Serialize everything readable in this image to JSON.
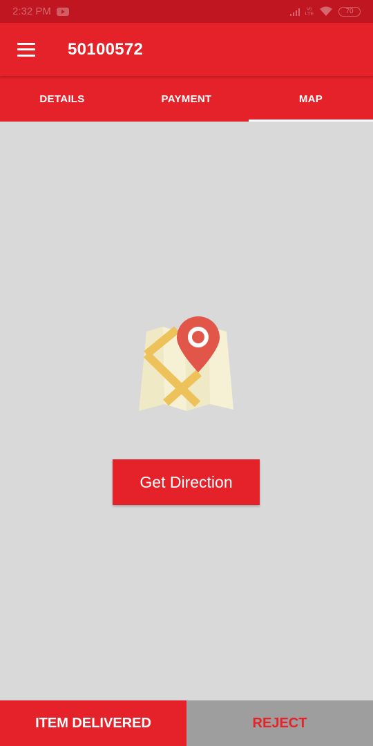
{
  "status_bar": {
    "time": "2:32 PM",
    "lte_label_top": "Vo",
    "lte_label_bottom": "LTE",
    "battery": "70"
  },
  "app_bar": {
    "title": "50100572",
    "menu_icon": "hamburger-menu-icon"
  },
  "tabs": [
    {
      "label": "DETAILS",
      "active": false
    },
    {
      "label": "PAYMENT",
      "active": false
    },
    {
      "label": "MAP",
      "active": true
    }
  ],
  "main": {
    "illustration": "map-pin-illustration",
    "get_direction_label": "Get Direction"
  },
  "actions": {
    "delivered_label": "ITEM DELIVERED",
    "reject_label": "REJECT"
  },
  "colors": {
    "primary": "#e52129",
    "status_bar": "#bf1622",
    "background": "#d9d9d9",
    "reject_bg": "#9e9e9e",
    "pin": "#e25549"
  }
}
